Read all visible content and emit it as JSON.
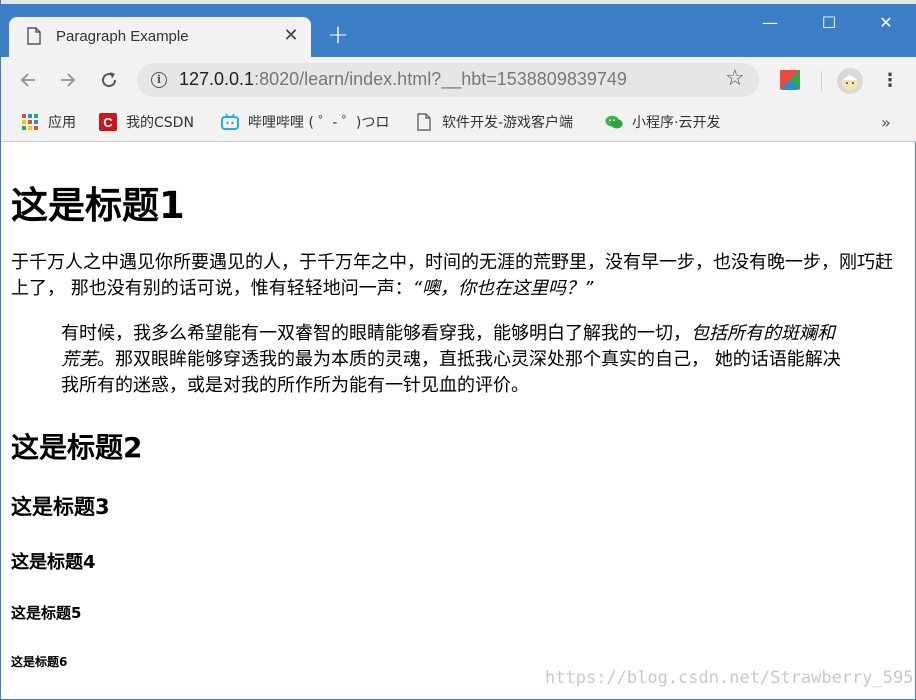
{
  "browser": {
    "tab_title": "Paragraph Example",
    "tab_close": "✕",
    "new_tab": "+",
    "window_buttons": {
      "minimize": "—",
      "maximize": "☐",
      "close": "✕"
    },
    "url_host": "127.0.0.1",
    "url_rest": ":8020/learn/index.html?__hbt=1538809839749",
    "icons": {
      "back": "arrow-left-icon",
      "forward": "arrow-right-icon",
      "reload": "reload-icon",
      "info": "info-icon",
      "star": "star-icon",
      "extension": "extension-icon",
      "profile": "avatar",
      "menu": "menu-dots-icon"
    }
  },
  "bookmarks": [
    {
      "label": "应用",
      "icon": "apps-grid-icon"
    },
    {
      "label": "我的CSDN",
      "icon": "csdn-icon"
    },
    {
      "label": "哔哩哔哩 ( ゜- ゜)つロ",
      "icon": "bilibili-icon"
    },
    {
      "label": "软件开发-游戏客户端",
      "icon": "page-icon"
    },
    {
      "label": "小程序·云开发",
      "icon": "wechat-icon"
    }
  ],
  "bookmarks_more": "»",
  "page": {
    "h1": "这是标题1",
    "paragraph_text": "于千万人之中遇见你所要遇见的人，于千万年之中，时间的无涯的荒野里，没有早一步，也没有晚一步，刚巧赶上了， 那也没有别的话可说，惟有轻轻地问一声：",
    "paragraph_em": "“噢，你也在这里吗？”",
    "quote_text_1": "有时候，我多么希望能有一双睿智的眼睛能够看穿我，能够明白了解我的一切，",
    "quote_em": "包括所有的斑斓和荒芜",
    "quote_text_2": "。那双眼眸能够穿透我的最为本质的灵魂，直抵我心灵深处那个真实的自己， 她的话语能解决我所有的迷惑，或是对我的所作所为能有一针见血的评价。",
    "h2": "这是标题2",
    "h3": "这是标题3",
    "h4": "这是标题4",
    "h5": "这是标题5",
    "h6": "这是标题6"
  },
  "watermark": "https://blog.csdn.net/Strawberry_595",
  "colors": {
    "titlebar": "#3b7ec6",
    "toolbar": "#f2f2f2",
    "omnibox": "#e6e6e6",
    "text": "#000000"
  }
}
